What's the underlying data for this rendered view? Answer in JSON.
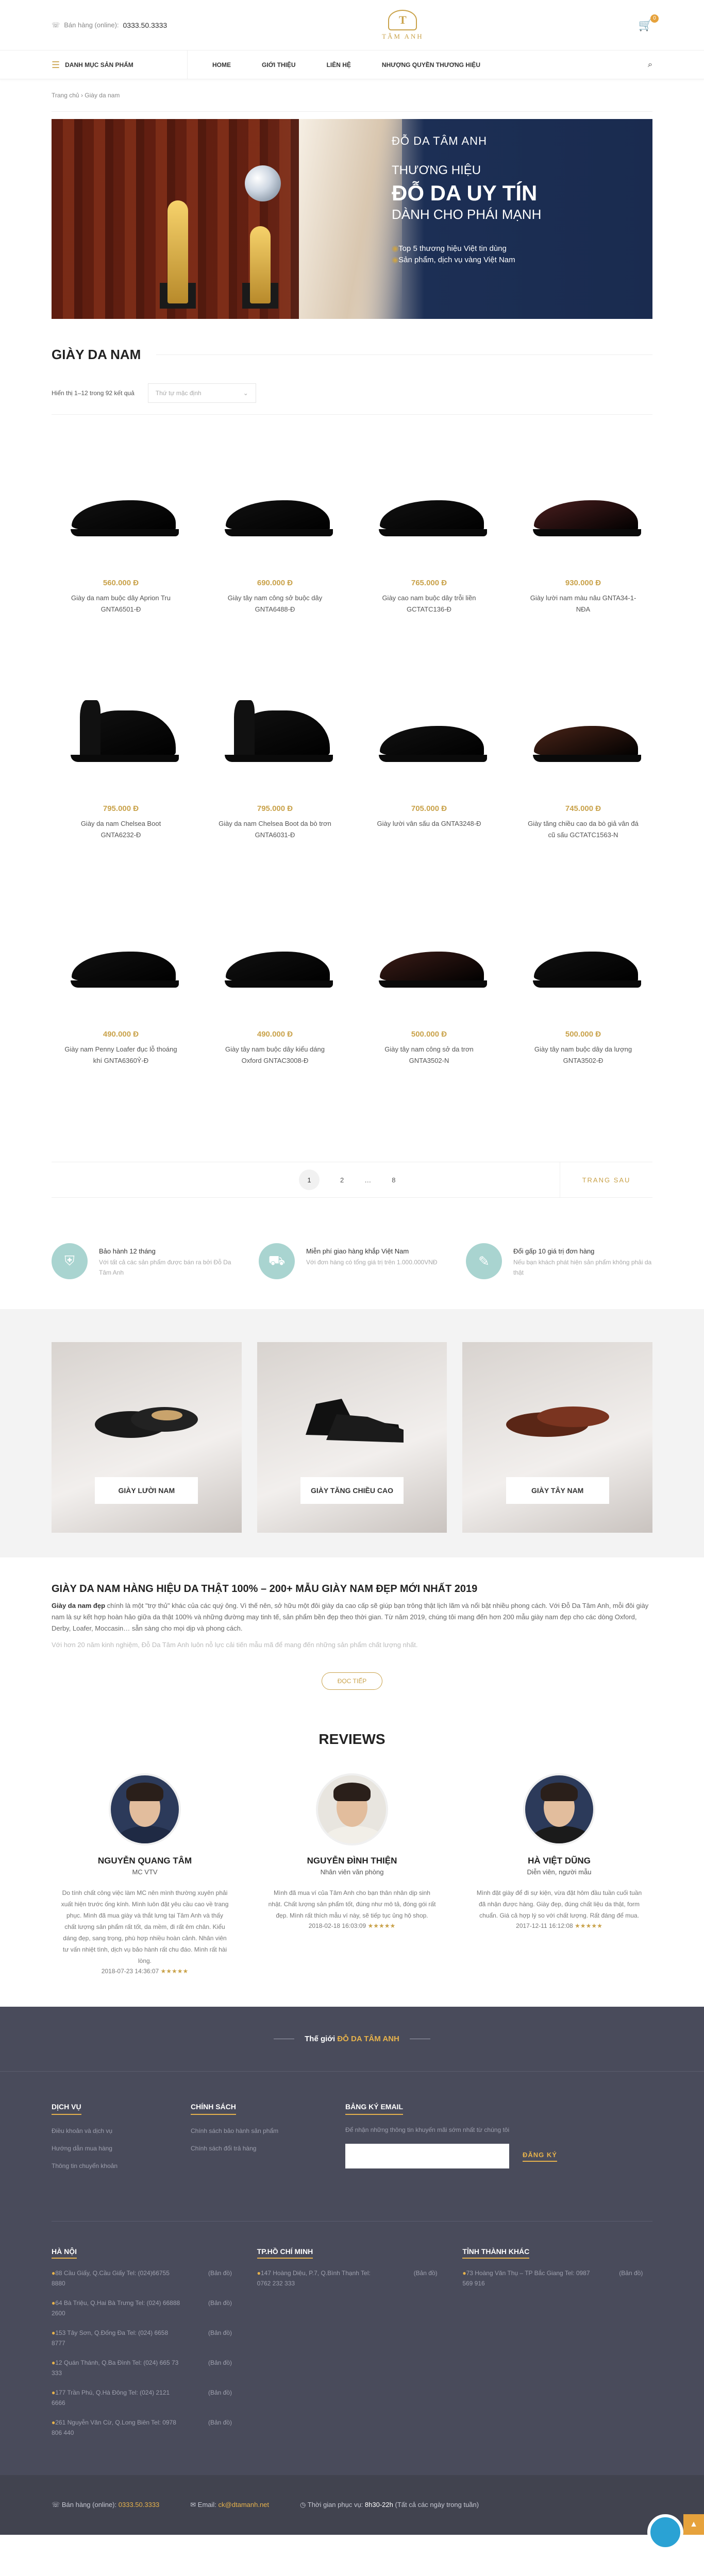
{
  "header": {
    "hotline_label": "Bán hàng (online):",
    "hotline": "0333.50.3333",
    "logo_text": "TÂM ANH",
    "cart_count": "0"
  },
  "nav": {
    "category_button": "DANH MỤC SẢN PHẨM",
    "items": [
      "HOME",
      "GIỚI THIỆU",
      "LIÊN HỆ",
      "NHƯỢNG QUYỀN THƯƠNG HIỆU"
    ]
  },
  "breadcrumb": {
    "home": "Trang chủ",
    "sep": "›",
    "current": "Giày da nam"
  },
  "banner": {
    "line1": "ĐỖ DA TÂM ANH",
    "line2": "THƯƠNG HIỆU",
    "line3": "ĐỖ DA UY TÍN",
    "line4": "DÀNH CHO PHÁI MẠNH",
    "bullet1": "Top 5 thương hiệu Việt tin dùng",
    "bullet2": "Sản phẩm, dịch vụ vàng Việt Nam"
  },
  "listing": {
    "title": "GIÀY DA NAM",
    "count_text": "Hiển thị 1–12 trong 92 kết quả",
    "sort_placeholder": "Thứ tự mặc định"
  },
  "products": [
    {
      "price": "560.000 Đ",
      "name": "Giày da nam buộc dây Aprion Tru GNTA6501-Đ",
      "color": "#111"
    },
    {
      "price": "690.000 Đ",
      "name": "Giày tây nam công sở buộc dây GNTA6488-Đ",
      "color": "#111"
    },
    {
      "price": "765.000 Đ",
      "name": "Giày cao nam buộc dây trỗi liền GCTATC136-Đ",
      "color": "#111"
    },
    {
      "price": "930.000 Đ",
      "name": "Giày lười nam màu nâu GNTA34-1-NĐA",
      "color": "#4a1e1e"
    },
    {
      "price": "795.000 Đ",
      "name": "Giày da nam Chelsea Boot GNTA6232-Đ",
      "color": "#111"
    },
    {
      "price": "795.000 Đ",
      "name": "Giày da nam Chelsea Boot da bò trơn GNTA6031-Đ",
      "color": "#111"
    },
    {
      "price": "705.000 Đ",
      "name": "Giày lười vân sấu da GNTA3248-Đ",
      "color": "#111"
    },
    {
      "price": "745.000 Đ",
      "name": "Giày tăng chiều cao da bò giả vân đá cũ sấu GCTATC1563-N",
      "color": "#4a2418"
    },
    {
      "price": "490.000 Đ",
      "name": "Giày nam Penny Loafer đục lỗ thoáng khí GNTA6360Ỷ-Đ",
      "color": "#111"
    },
    {
      "price": "490.000 Đ",
      "name": "Giày tây nam buộc dây kiểu dáng Oxford GNTAC3008-Đ",
      "color": "#111"
    },
    {
      "price": "500.000 Đ",
      "name": "Giày tây nam công sở da trơn GNTA3502-N",
      "color": "#3b1c17"
    },
    {
      "price": "500.000 Đ",
      "name": "Giày tây nam buộc dây da lượng GNTA3502-Đ",
      "color": "#111"
    }
  ],
  "pagination": {
    "current": "1",
    "p2": "2",
    "dots": "…",
    "last": "8",
    "next": "TRANG SAU"
  },
  "features": [
    {
      "title": "Bảo hành 12 tháng",
      "desc": "Với tất cả các sản phẩm được bán ra bởi Đỗ Da Tâm Anh",
      "icon": "shield-icon"
    },
    {
      "title": "Miễn phí giao hàng khắp Việt Nam",
      "desc": "Với đơn hàng có tổng giá trị trên 1.000.000VNĐ",
      "icon": "truck-icon"
    },
    {
      "title": "Đổi gấp 10 giá trị đơn hàng",
      "desc": "Nếu bạn khách phát hiện sản phẩm không phải da thật",
      "icon": "tag-icon"
    }
  ],
  "categories": [
    {
      "label": "GIÀY LƯỜI NAM"
    },
    {
      "label": "GIÀY TĂNG CHIỀU CAO"
    },
    {
      "label": "GIÀY TÂY NAM"
    }
  ],
  "article": {
    "title": "GIÀY DA NAM HÀNG HIỆU DA THẬT 100% – 200+ MẪU GIÀY NAM ĐẸP MỚI NHẤT 2019",
    "lead": "Giày da nam đẹp",
    "p1": " chính là một \"trợ thủ\" khác của các quý ông. Vì thế nên, sở hữu một đôi giày da cao cấp sẽ giúp bạn trông thật lịch lãm và nổi bật nhiều phong cách. Với Đỗ Da Tâm Anh, mỗi đôi giày nam là sự kết hợp hoàn hảo giữa da thật 100% và những đường may tinh tế, sản phẩm bền đẹp theo thời gian. Từ năm 2019, chúng tôi mang đến hơn 200 mẫu giày nam đẹp cho các dòng Oxford, Derby, Loafer, Moccasin… sẵn sàng cho mọi dịp và phong cách.",
    "p2": "Với hơn 20 năm kinh nghiệm, Đỗ Da Tâm Anh luôn nỗ lực cải tiến mẫu mã để mang đến những sản phẩm chất lượng nhất.",
    "readmore": "ĐỌC TIẾP"
  },
  "reviews_title": "REVIEWS",
  "reviews": [
    {
      "name": "NGUYỄN QUANG TÂM",
      "role": "MC VTV",
      "text": "Do tính chất công việc làm MC nên mình thường xuyên phải xuất hiện trước ống kính. Mình luôn đặt yêu cầu cao về trang phục. Mình đã mua giày và thắt lưng tại Tâm Anh và thấy chất lượng sản phẩm rất tốt, da mềm, đi rất êm chân. Kiểu dáng đẹp, sang trọng, phù hợp nhiều hoàn cảnh. Nhân viên tư vấn nhiệt tình, dịch vụ bảo hành rất chu đáo. Mình rất hài lòng.",
      "date": "2018-07-23 14:36:07",
      "stars": "★★★★★"
    },
    {
      "name": "NGUYỄN ĐÌNH THIỆN",
      "role": "Nhân viên văn phòng",
      "text": "Mình đã mua ví của Tâm Anh cho bạn thân nhân dịp sinh nhật. Chất lượng sản phẩm tốt, đúng như mô tả, đóng gói rất đẹp. Mình rất thích mẫu ví này, sẽ tiếp tục ủng hộ shop.",
      "date": "2018-02-18 16:03:09",
      "stars": "★★★★★"
    },
    {
      "name": "HÀ VIỆT DŨNG",
      "role": "Diễn viên, người mẫu",
      "text": "Mình đặt giày để đi sự kiện, vừa đặt hôm đầu tuần cuối tuần đã nhận được hàng. Giày đẹp, đúng chất liệu da thật, form chuẩn. Giá cả hợp lý so với chất lượng. Rất đáng để mua.",
      "date": "2017-12-11 16:12:08",
      "stars": "★★★★★"
    }
  ],
  "footer": {
    "heading_prefix": "Thế giới",
    "heading_brand": "ĐỖ DA TÂM ANH",
    "col1_title": "DỊCH VỤ",
    "col1_items": [
      "Điều khoản và dịch vụ",
      "Hướng dẫn mua hàng",
      "Thông tin chuyển khoản"
    ],
    "col2_title": "CHÍNH SÁCH",
    "col2_items": [
      "Chính sách bảo hành sản phẩm",
      "Chính sách đổi trả hàng"
    ],
    "col3_title": "BẢNG KÝ EMAIL",
    "col3_text": "Để nhận những thông tin khuyến mãi sớm nhất từ chúng tôi",
    "subscribe": "ĐĂNG KÝ",
    "stores": [
      {
        "title": "HÀ NỘI",
        "items": [
          {
            "addr": "88 Cầu Giấy, Q.Cầu Giấy Tel: (024)66755 8880",
            "map": "(Bản đồ)"
          },
          {
            "addr": "64 Bà Triệu, Q.Hai Bà Trưng Tel: (024) 66888 2600",
            "map": "(Bản đồ)"
          },
          {
            "addr": "153 Tây Sơn, Q.Đống Đa Tel: (024) 6658 8777",
            "map": "(Bản đồ)"
          },
          {
            "addr": "12 Quán Thánh, Q.Ba Đình Tel: (024) 665 73 333",
            "map": "(Bản đồ)"
          },
          {
            "addr": "177 Trần Phú, Q.Hà Đông Tel: (024) 2121 6666",
            "map": "(Bản đồ)"
          },
          {
            "addr": "261 Nguyễn Văn Cừ, Q.Long Biên Tel: 0978 806 440",
            "map": "(Bản đồ)"
          }
        ]
      },
      {
        "title": "TP.HỒ CHÍ MINH",
        "items": [
          {
            "addr": "147 Hoàng Diệu, P.7, Q.Bình Thạnh Tel: 0762 232 333",
            "map": "(Bản đồ)"
          }
        ]
      },
      {
        "title": "TỈNH THÀNH KHÁC",
        "items": [
          {
            "addr": "73 Hoàng Văn Thụ – TP Bắc Giang Tel: 0987 569 916",
            "map": "(Bản đồ)"
          }
        ]
      }
    ],
    "bottom": {
      "hotline_label": "Bán hàng (online):",
      "hotline": "0333.50.3333",
      "email_label": "Email:",
      "email": "ck@dtamanh.net",
      "hours_label": "Thời gian phục vụ:",
      "hours": "8h30-22h",
      "hours_note": "(Tất cả các ngày trong tuần)"
    }
  }
}
